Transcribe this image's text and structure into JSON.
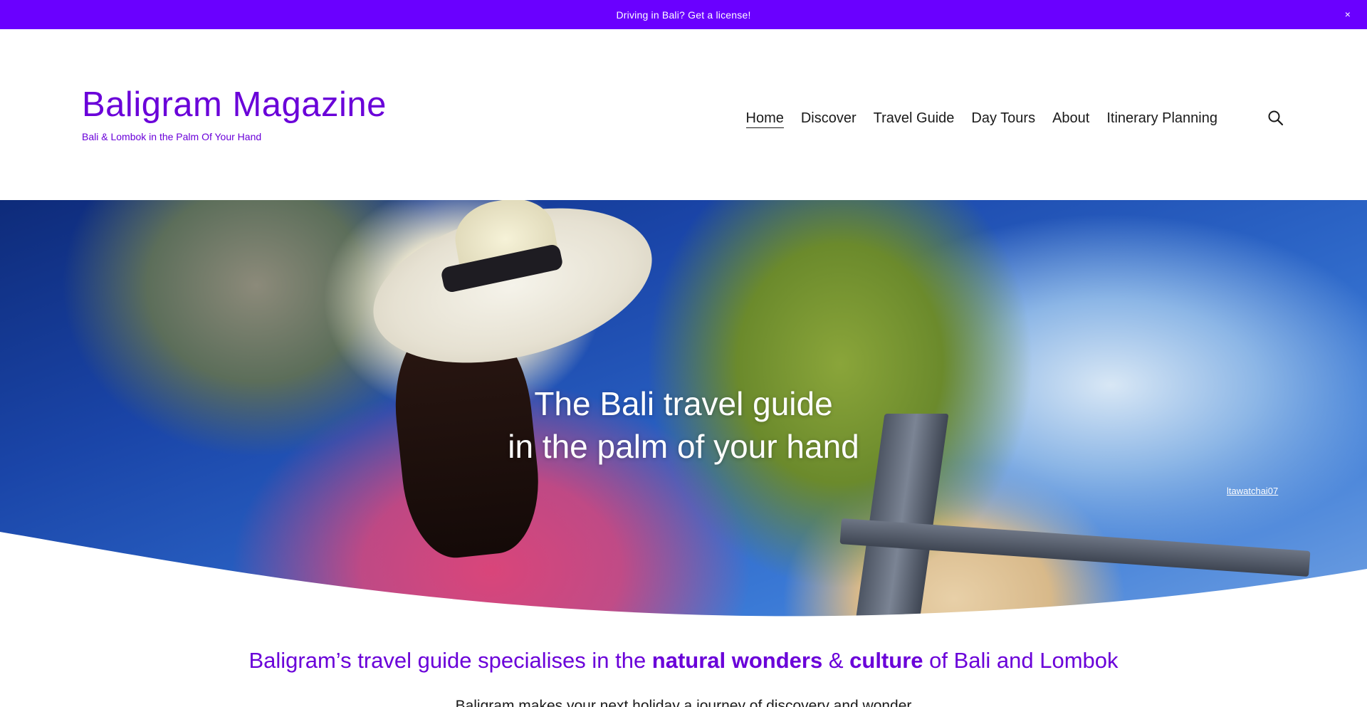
{
  "announcement": {
    "text": "Driving in Bali? Get a license!",
    "close_label": "×"
  },
  "site": {
    "title": "Baligram Magazine",
    "tagline": "Bali & Lombok in the Palm Of Your Hand",
    "accent_color": "#6a00d9",
    "banner_color": "#6a00ff"
  },
  "nav": {
    "items": [
      {
        "label": "Home",
        "active": true
      },
      {
        "label": "Discover"
      },
      {
        "label": "Travel Guide"
      },
      {
        "label": "Day Tours"
      },
      {
        "label": "About"
      },
      {
        "label": "Itinerary Planning"
      }
    ],
    "search_icon": "search-icon"
  },
  "hero": {
    "line1": "The Bali travel guide",
    "line2": "in the palm of your hand",
    "photo_credit": "ltawatchai07"
  },
  "intro": {
    "part1": "Baligram’s travel guide specialises in the ",
    "bold1": "natural wonders",
    "part2": " & ",
    "bold2": "culture",
    "part3": " of Bali and Lombok",
    "subtext": "Baligram makes your next holiday a journey of discovery and wonder"
  }
}
